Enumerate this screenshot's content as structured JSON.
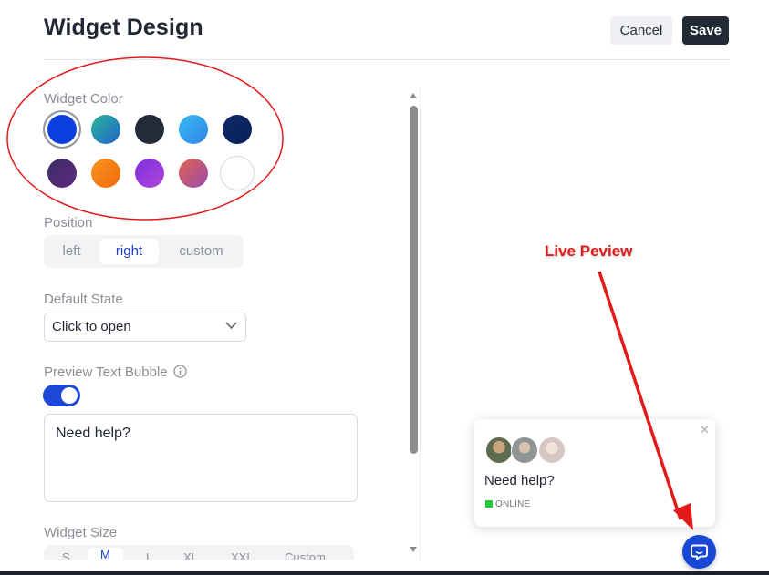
{
  "header": {
    "title": "Widget Design",
    "cancel_label": "Cancel",
    "save_label": "Save"
  },
  "widget_color": {
    "label": "Widget Color",
    "selected_index": 0,
    "swatches": [
      "#0b3fe0",
      "linear-gradient(135deg,#2ab59a,#2163c9)",
      "#232a3a",
      "linear-gradient(135deg,#3bb9f4,#2f86e6)",
      "linear-gradient(135deg,#0f2a6b,#082057)",
      "linear-gradient(135deg,#3b2c63,#5d2a80)",
      "linear-gradient(135deg,#f7941d,#f26a0c)",
      "linear-gradient(135deg,#7b2fe2,#b246d6)",
      "linear-gradient(135deg,#e0634a,#9b4ab2)",
      "#ffffff"
    ]
  },
  "position": {
    "label": "Position",
    "options": [
      "left",
      "right",
      "custom"
    ],
    "selected": "right"
  },
  "default_state": {
    "label": "Default State",
    "value": "Click to open"
  },
  "preview_bubble": {
    "label": "Preview Text Bubble",
    "enabled": true,
    "text": "Need help?"
  },
  "widget_size": {
    "label": "Widget Size",
    "options": [
      "S",
      "M",
      "L",
      "XL",
      "XXL",
      "Custom"
    ],
    "selected": "M"
  },
  "preview": {
    "bubble_text": "Need help?",
    "status_text": "ONLINE",
    "annotation": "Live Peview"
  },
  "colors": {
    "accent": "#1d47d8",
    "online": "#22c93d",
    "annotation": "#e21c1c"
  }
}
